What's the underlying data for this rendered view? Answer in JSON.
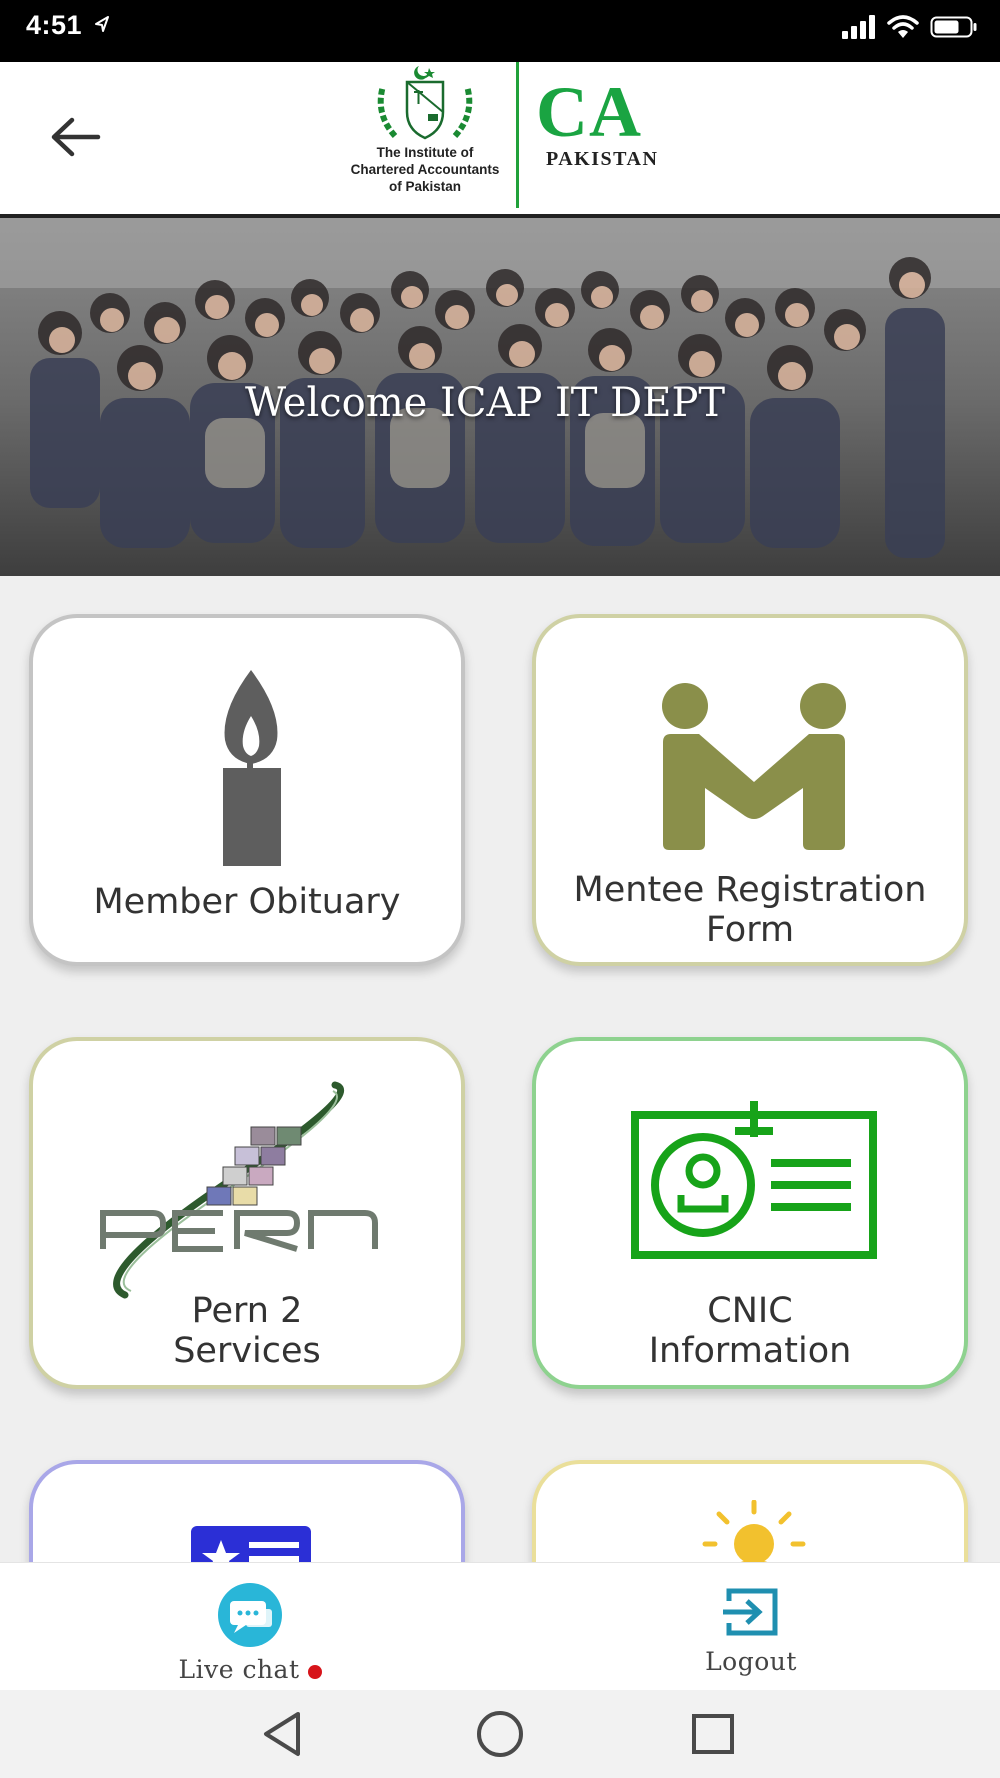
{
  "status_bar": {
    "time": "4:51"
  },
  "header": {
    "back_label": "Back",
    "logo_small_line1": "The Institute of",
    "logo_small_line2": "Chartered Accountants",
    "logo_small_line3": "of Pakistan",
    "logo_ca": "CA",
    "logo_pakistan": "PAKISTAN"
  },
  "banner": {
    "title": "Welcome ICAP IT DEPT"
  },
  "tiles": [
    {
      "line1": "Member Obituary",
      "line2": "",
      "border": "#c4c4c4",
      "icon": "candle-icon"
    },
    {
      "line1": "Mentee Registration",
      "line2": "Form",
      "border": "#cfd1a4",
      "icon": "mentee-handshake-icon"
    },
    {
      "line1": "Pern 2",
      "line2": "Services",
      "border": "#cfd1a4",
      "icon": "pern-logo-icon"
    },
    {
      "line1": "CNIC",
      "line2": "Information",
      "border": "#8ed28f",
      "icon": "id-card-icon"
    },
    {
      "line1": "",
      "line2": "",
      "border": "#a9a7e8",
      "icon": "star-card-icon"
    },
    {
      "line1": "",
      "line2": "",
      "border": "#eadf9a",
      "icon": "bright-user-icon"
    }
  ],
  "bottom_nav": {
    "live_chat": "Live chat",
    "logout": "Logout"
  },
  "colors": {
    "brand_green": "#1aa442",
    "chat_teal": "#29b6d8",
    "mentee_olive": "#8a8f4a",
    "cnic_green": "#17a319",
    "notification_red": "#d7141a"
  }
}
